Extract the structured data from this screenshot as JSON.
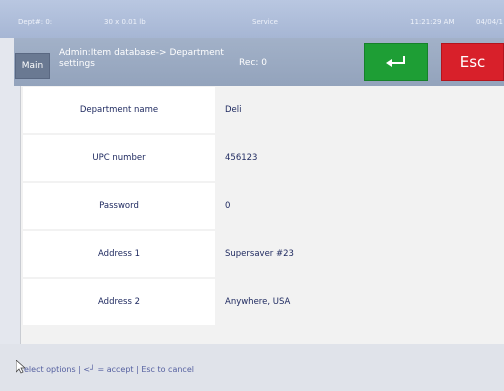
{
  "status": {
    "dept": "Dept#: 0:",
    "weight": "30 x 0.01 lb",
    "mode": "Service",
    "time": "11:21:29 AM",
    "date": "04/04/1"
  },
  "header": {
    "main_label": "Main",
    "breadcrumb": "Admin:Item database-> Department settings",
    "record": "Rec: 0",
    "enter_label": "↵",
    "esc_label": "Esc"
  },
  "fields": [
    {
      "label": "Department name",
      "value": "Deli"
    },
    {
      "label": "UPC number",
      "value": "456123"
    },
    {
      "label": "Password",
      "value": "0"
    },
    {
      "label": "Address 1",
      "value": "Supersaver #23"
    },
    {
      "label": "Address 2",
      "value": "Anywhere, USA"
    }
  ],
  "footer": {
    "hint": "elect options | <┘ = accept | Esc to cancel"
  },
  "colors": {
    "accept": "#1e9e35",
    "cancel": "#d8202a",
    "title_bar": "#9aa9c2"
  }
}
